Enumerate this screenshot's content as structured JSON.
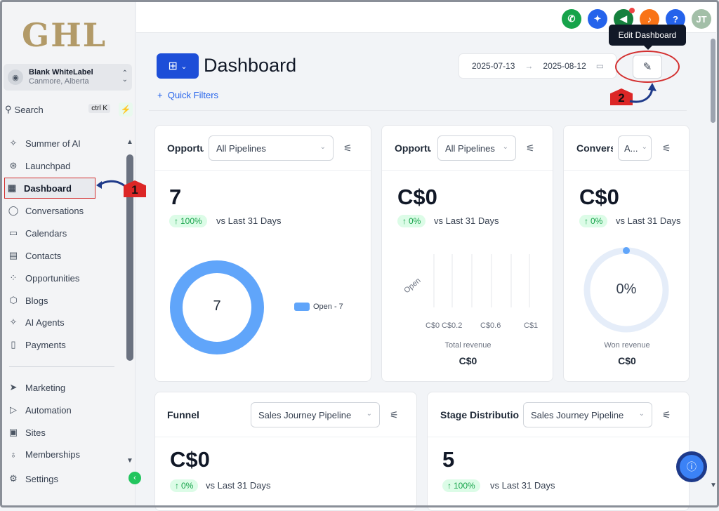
{
  "brand": {
    "logo": "GHL"
  },
  "account": {
    "name": "Blank WhiteLabel",
    "location": "Canmore, Alberta"
  },
  "search": {
    "placeholder": "Search",
    "shortcut": "ctrl K"
  },
  "sidebar": {
    "items": [
      {
        "label": "Summer of AI",
        "icon": "sparkle-icon"
      },
      {
        "label": "Launchpad",
        "icon": "rocket-icon"
      },
      {
        "label": "Dashboard",
        "icon": "grid-icon"
      },
      {
        "label": "Conversations",
        "icon": "chat-icon"
      },
      {
        "label": "Calendars",
        "icon": "calendar-icon"
      },
      {
        "label": "Contacts",
        "icon": "contacts-icon"
      },
      {
        "label": "Opportunities",
        "icon": "pipeline-icon"
      },
      {
        "label": "Blogs",
        "icon": "cube-icon"
      },
      {
        "label": "AI Agents",
        "icon": "sparkle-icon"
      },
      {
        "label": "Payments",
        "icon": "receipt-icon"
      }
    ],
    "items2": [
      {
        "label": "Marketing",
        "icon": "send-icon"
      },
      {
        "label": "Automation",
        "icon": "automation-icon"
      },
      {
        "label": "Sites",
        "icon": "site-icon"
      },
      {
        "label": "Memberships",
        "icon": "badge-icon"
      },
      {
        "label": "Settings",
        "icon": "gear-icon"
      }
    ]
  },
  "annotations": {
    "one": "1",
    "two": "2"
  },
  "topbar": {
    "help": "?",
    "user_initials": "JT",
    "colors": {
      "phone": "#16a34a",
      "ai": "#2563eb",
      "megaphone": "#15803d",
      "bell": "#f97316",
      "help": "#2563eb",
      "avatar": "#a3bfa8"
    }
  },
  "page": {
    "title": "Dashboard",
    "quick_filters": "Quick Filters",
    "date_from": "2025-07-13",
    "date_to": "2025-08-12",
    "edit_tooltip": "Edit Dashboard"
  },
  "cards": {
    "opp_count": {
      "title": "Opportunities",
      "select": "All Pipelines",
      "value": "7",
      "change": "100%",
      "vs": "vs Last 31 Days",
      "donut_value": "7",
      "legend": "Open - 7"
    },
    "opp_value": {
      "title": "Opportunity Value",
      "select": "All Pipelines",
      "value": "C$0",
      "change": "0%",
      "vs": "vs Last 31 Days",
      "ylabel": "Open",
      "xticks": [
        "C$0",
        "C$0.2",
        "C$0.6",
        "C$1"
      ],
      "xlabel": "Total revenue",
      "total": "C$0"
    },
    "conversion": {
      "title": "Conversion Rate",
      "select": "A...",
      "value": "C$0",
      "change": "0%",
      "vs": "vs Last 31 Days",
      "gauge": "0%",
      "sub": "Won revenue",
      "total": "C$0"
    },
    "funnel": {
      "title": "Funnel",
      "select": "Sales Journey Pipeline",
      "value": "C$0",
      "change": "0%",
      "vs": "vs Last 31 Days"
    },
    "stage": {
      "title": "Stage Distribution",
      "select": "Sales Journey Pipeline",
      "value": "5",
      "change": "100%",
      "vs": "vs Last 31 Days"
    }
  }
}
